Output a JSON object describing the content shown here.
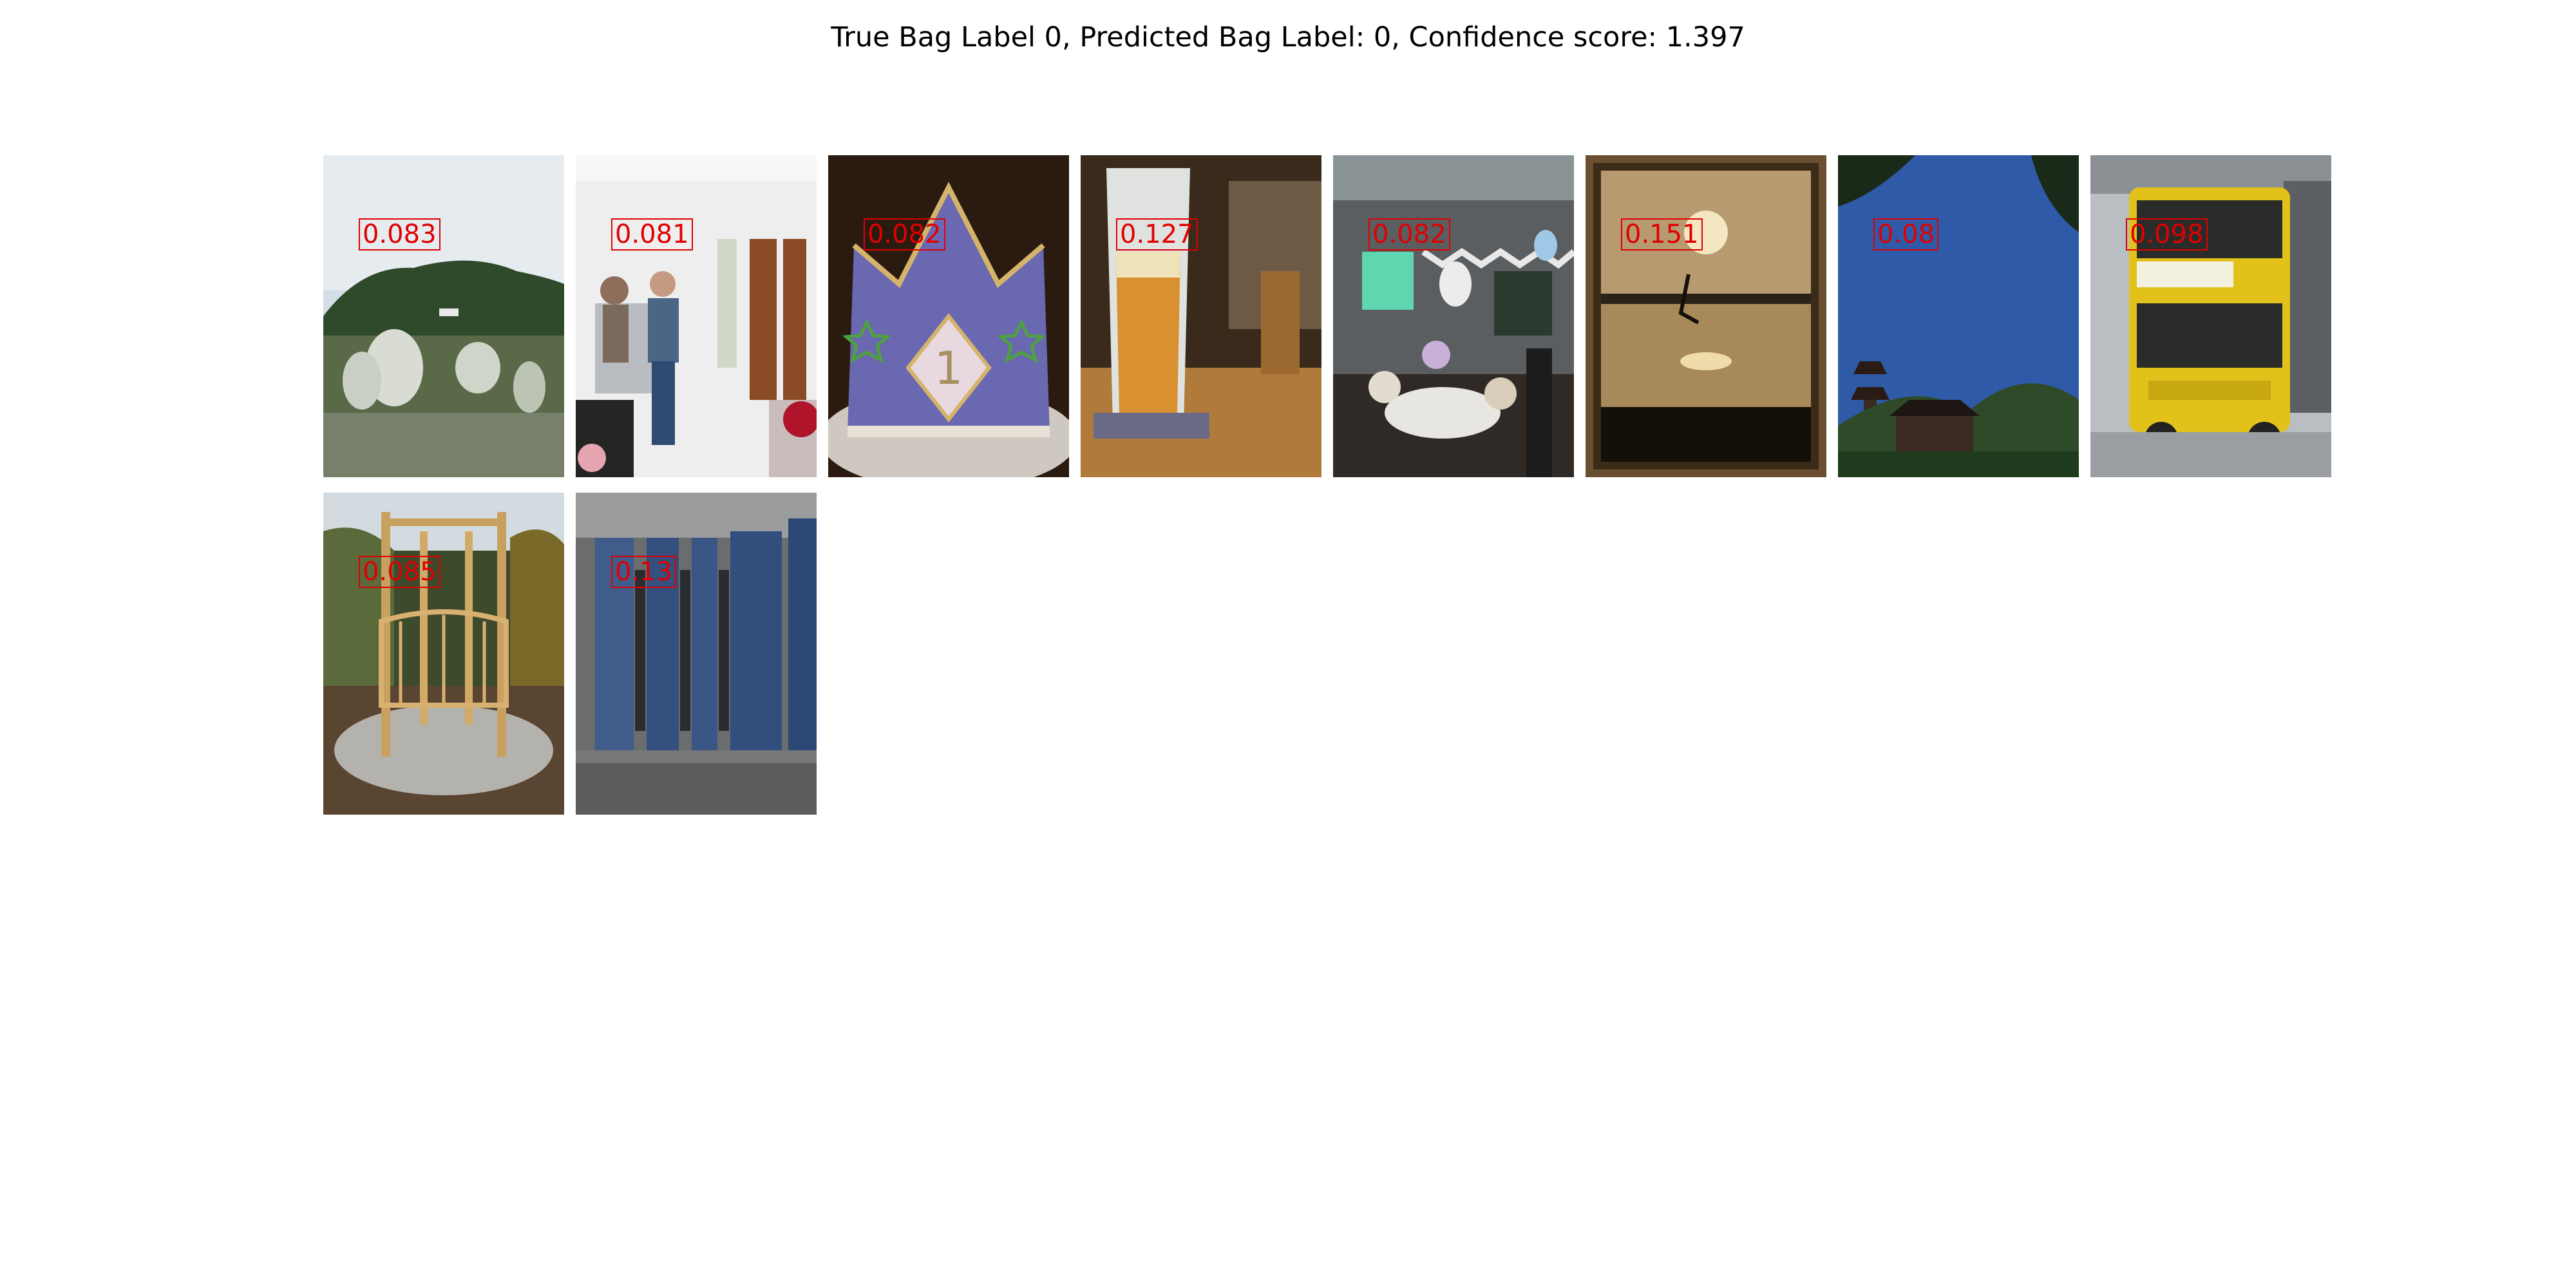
{
  "title": "True Bag Label 0, Predicted Bag Label: 0, Confidence score: 1.397",
  "tiles": [
    {
      "score": "0.083",
      "scene": "grassland-icon"
    },
    {
      "score": "0.081",
      "scene": "office-people-icon"
    },
    {
      "score": "0.082",
      "scene": "crown-cake-icon"
    },
    {
      "score": "0.127",
      "scene": "beer-glass-icon"
    },
    {
      "score": "0.082",
      "scene": "party-room-icon"
    },
    {
      "score": "0.151",
      "scene": "sunset-lake-icon"
    },
    {
      "score": "0.08",
      "scene": "pagoda-sky-icon"
    },
    {
      "score": "0.098",
      "scene": "yellow-bus-icon"
    },
    {
      "score": "0.085",
      "scene": "wooden-gazebo-icon"
    },
    {
      "score": "0.13",
      "scene": "restroom-stalls-icon"
    }
  ],
  "colors": {
    "score_label": "#e00000",
    "title": "#000000"
  }
}
